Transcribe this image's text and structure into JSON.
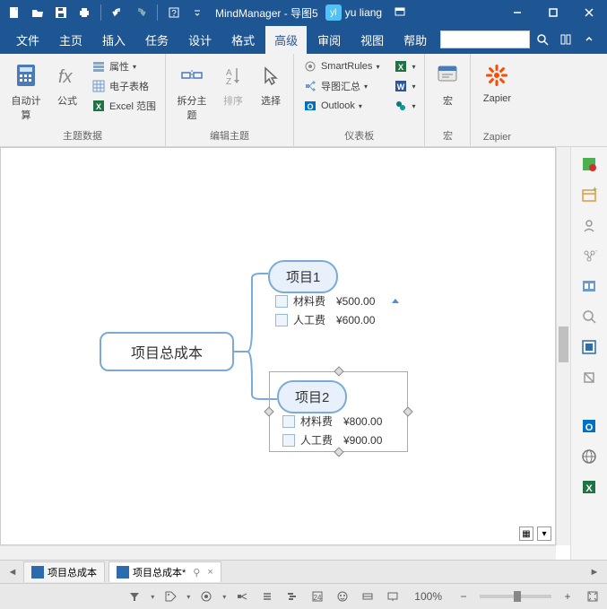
{
  "app": {
    "name": "MindManager",
    "doc": "导图5",
    "user_initials": "yl",
    "user_name": "yu liang"
  },
  "menu": {
    "file": "文件",
    "home": "主页",
    "insert": "插入",
    "tasks": "任务",
    "design": "设计",
    "format": "格式",
    "advanced": "高级",
    "review": "审阅",
    "view": "视图",
    "help": "帮助"
  },
  "ribbon": {
    "grp_topic_data": "主题数据",
    "grp_edit_topic": "编辑主题",
    "grp_dashboard": "仪表板",
    "grp_macro": "宏",
    "grp_zapier": "Zapier",
    "auto_calc": "自动计算",
    "formula": "公式",
    "property": "属性",
    "spreadsheet": "电子表格",
    "excel_range": "Excel 范围",
    "split_topic": "拆分主题",
    "sort": "排序",
    "select": "选择",
    "smartrules": "SmartRules",
    "map_collection": "导图汇总",
    "outlook": "Outlook",
    "macro": "宏",
    "zapier": "Zapier"
  },
  "map": {
    "root": "项目总成本",
    "topic1": {
      "title": "项目1",
      "rows": [
        {
          "label": "材料费",
          "val": "¥500.00"
        },
        {
          "label": "人工费",
          "val": "¥600.00"
        }
      ]
    },
    "topic2": {
      "title": "项目2",
      "rows": [
        {
          "label": "材料费",
          "val": "¥800.00"
        },
        {
          "label": "人工费",
          "val": "¥900.00"
        }
      ]
    }
  },
  "tabs": {
    "t1": "项目总成本",
    "t2": "项目总成本*"
  },
  "status": {
    "zoom": "100%"
  }
}
